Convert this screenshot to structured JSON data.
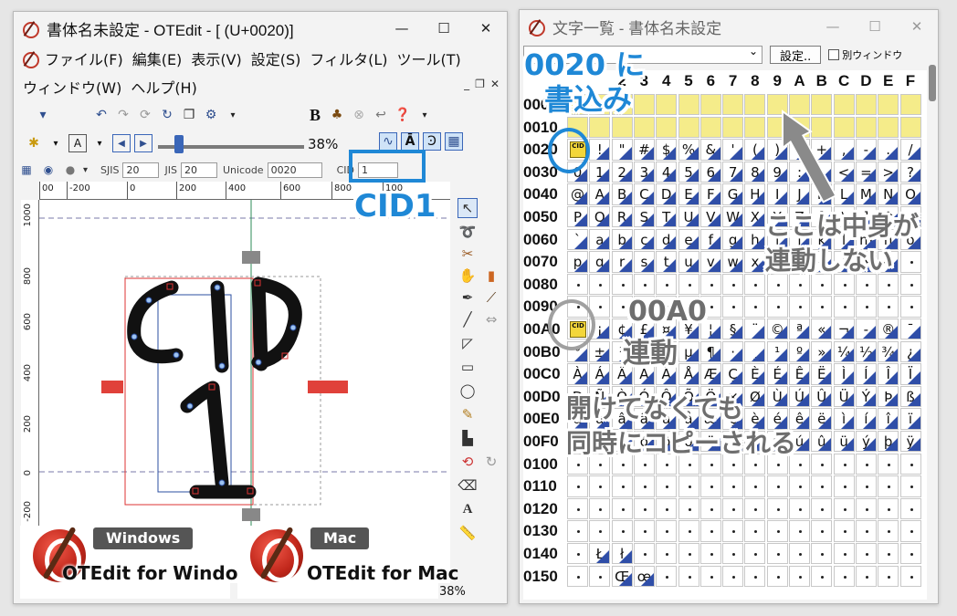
{
  "left_window": {
    "title": "書体名未設定 - OTEdit - [ (U+0020)]",
    "controls": {
      "minimize": "—",
      "maximize": "☐",
      "close": "✕"
    },
    "menu_row1": [
      "ファイル(F)",
      "編集(E)",
      "表示(V)",
      "設定(S)",
      "フィルタ(L)",
      "ツール(T)"
    ],
    "menu_row2": [
      "ウィンドウ(W)",
      "ヘルプ(H)"
    ],
    "mdi_controls": {
      "minimize": "_",
      "restore": "❐",
      "close": "✕"
    },
    "bold_label": "B",
    "zoom_value": "38%",
    "info": {
      "sjis_label": "SJIS",
      "sjis_value": "20",
      "jis_label": "JIS",
      "jis_value": "20",
      "unicode_label": "Unicode",
      "unicode_value": "0020",
      "cid_label": "CID",
      "cid_value": "1"
    },
    "ruler_h_labels": [
      "00",
      "-200",
      "0",
      "200",
      "400",
      "600",
      "800",
      "100"
    ],
    "ruler_v_labels": [
      "1000",
      "800",
      "600",
      "400",
      "200",
      "0",
      "-200"
    ],
    "glyph_text_top": "CID",
    "glyph_text_bottom": "1",
    "bottom_zoom": "38%"
  },
  "right_window": {
    "title": "文字一覧 - 書体名未設定",
    "controls": {
      "minimize": "—",
      "maximize": "☐",
      "close": "✕"
    },
    "settings_button": "設定..",
    "checkbox_label": "別ウィンドウ",
    "col_headers": [
      "2",
      "3",
      "4",
      "5",
      "6",
      "7",
      "8",
      "9",
      "A",
      "B",
      "C",
      "D",
      "E",
      "F"
    ],
    "row_headers": [
      "0000",
      "0010",
      "0020",
      "0030",
      "0040",
      "0050",
      "0060",
      "0070",
      "0080",
      "0090",
      "00A0",
      "00B0",
      "00C0",
      "00D0",
      "00E0",
      "00F0",
      "0100",
      "0110",
      "0120",
      "0130",
      "0140",
      "0150"
    ],
    "rows": [
      [
        "",
        "",
        "",
        "",
        "",
        "",
        "",
        "",
        "",
        "",
        "",
        "",
        "",
        "",
        "",
        ""
      ],
      [
        "",
        "",
        "",
        "",
        "",
        "",
        "",
        "",
        "",
        "",
        "",
        "",
        "",
        "",
        "",
        ""
      ],
      [
        "",
        "!",
        "\"",
        "#",
        "$",
        "%",
        "&",
        "'",
        "(",
        ")",
        "*",
        "+",
        ",",
        "-",
        ".",
        "/"
      ],
      [
        "0",
        "1",
        "2",
        "3",
        "4",
        "5",
        "6",
        "7",
        "8",
        "9",
        ":",
        ";",
        "<",
        "=",
        ">",
        "?"
      ],
      [
        "@",
        "A",
        "B",
        "C",
        "D",
        "E",
        "F",
        "G",
        "H",
        "I",
        "J",
        "K",
        "L",
        "M",
        "N",
        "O"
      ],
      [
        "P",
        "Q",
        "R",
        "S",
        "T",
        "U",
        "V",
        "W",
        "X",
        "Y",
        "Z",
        "[",
        "\\",
        "]",
        "^",
        "_"
      ],
      [
        "`",
        "a",
        "b",
        "c",
        "d",
        "e",
        "f",
        "g",
        "h",
        "i",
        "j",
        "k",
        "l",
        "m",
        "n",
        "o"
      ],
      [
        "p",
        "q",
        "r",
        "s",
        "t",
        "u",
        "v",
        "w",
        "x",
        "y",
        "z",
        "{",
        "|",
        "}",
        "~",
        ""
      ],
      [
        "",
        "",
        "",
        "",
        "",
        "",
        "",
        "",
        "",
        "",
        "",
        "",
        "",
        "",
        "",
        ""
      ],
      [
        "",
        "",
        "",
        "",
        "",
        "",
        "",
        "",
        "",
        "",
        "",
        "",
        "",
        "",
        "",
        ""
      ],
      [
        "",
        "¡",
        "¢",
        "£",
        "¤",
        "¥",
        "¦",
        "§",
        "¨",
        "©",
        "ª",
        "«",
        "¬",
        "-",
        "®",
        "¯"
      ],
      [
        "°",
        "±",
        "²",
        "³",
        "´",
        "µ",
        "¶",
        "·",
        "¸",
        "¹",
        "º",
        "»",
        "¼",
        "½",
        "¾",
        "¿"
      ],
      [
        "À",
        "Á",
        "Â",
        "Ã",
        "Ä",
        "Å",
        "Æ",
        "Ç",
        "È",
        "É",
        "Ê",
        "Ë",
        "Ì",
        "Í",
        "Î",
        "Ï"
      ],
      [
        "Ð",
        "Ñ",
        "Ò",
        "Ó",
        "Ô",
        "Õ",
        "Ö",
        "×",
        "Ø",
        "Ù",
        "Ú",
        "Û",
        "Ü",
        "Ý",
        "Þ",
        "ß"
      ],
      [
        "à",
        "á",
        "â",
        "ã",
        "ä",
        "å",
        "æ",
        "ç",
        "è",
        "é",
        "ê",
        "ë",
        "ì",
        "í",
        "î",
        "ï"
      ],
      [
        "ð",
        "ñ",
        "ò",
        "ó",
        "ô",
        "õ",
        "ö",
        "÷",
        "ø",
        "ù",
        "ú",
        "û",
        "ü",
        "ý",
        "þ",
        "ÿ"
      ],
      [
        "",
        "",
        "",
        "",
        "",
        "",
        "",
        "",
        "",
        "",
        "",
        "",
        "",
        "",
        "",
        ""
      ],
      [
        "",
        "",
        "",
        "",
        "",
        "",
        "",
        "",
        "",
        "",
        "",
        "",
        "",
        "",
        "",
        ""
      ],
      [
        "",
        "",
        "",
        "",
        "",
        "",
        "",
        "",
        "",
        "",
        "",
        "",
        "",
        "",
        "",
        ""
      ],
      [
        "",
        "",
        "",
        "",
        "",
        "",
        "",
        "",
        "",
        "",
        "",
        "",
        "",
        "",
        "",
        ""
      ],
      [
        "",
        "Ł",
        "ł",
        "",
        "",
        "",
        "",
        "",
        "",
        "",
        "",
        "",
        "",
        "",
        "",
        ""
      ],
      [
        "",
        "",
        "Œ",
        "œ",
        "",
        "",
        "",
        "",
        "",
        "",
        "",
        "",
        "",
        "",
        "",
        ""
      ]
    ],
    "cid_badge_text": "CID"
  },
  "annotations": {
    "write_line1": "0020 に",
    "write_line2": "書込み",
    "cid1": "CID1",
    "linked_line1": "00A0",
    "linked_line2": "連動",
    "not_linked_line1": "ここは中身が",
    "not_linked_line2": "連動しない",
    "copied_line1": "開けてなくても",
    "copied_line2": "同時にコピーされる"
  },
  "badges": {
    "windows_tag": "Windows",
    "windows_name": "OTEdit for Windows",
    "mac_tag": "Mac",
    "mac_name": "OTEdit for Mac"
  },
  "colors": {
    "annotation_blue": "#1f88d6",
    "annotation_gray": "#6e6e6e",
    "highlight_yellow": "#f5ec8a",
    "glyph_marker_blue": "#2f4ea8",
    "guide_red": "#e0413a"
  }
}
